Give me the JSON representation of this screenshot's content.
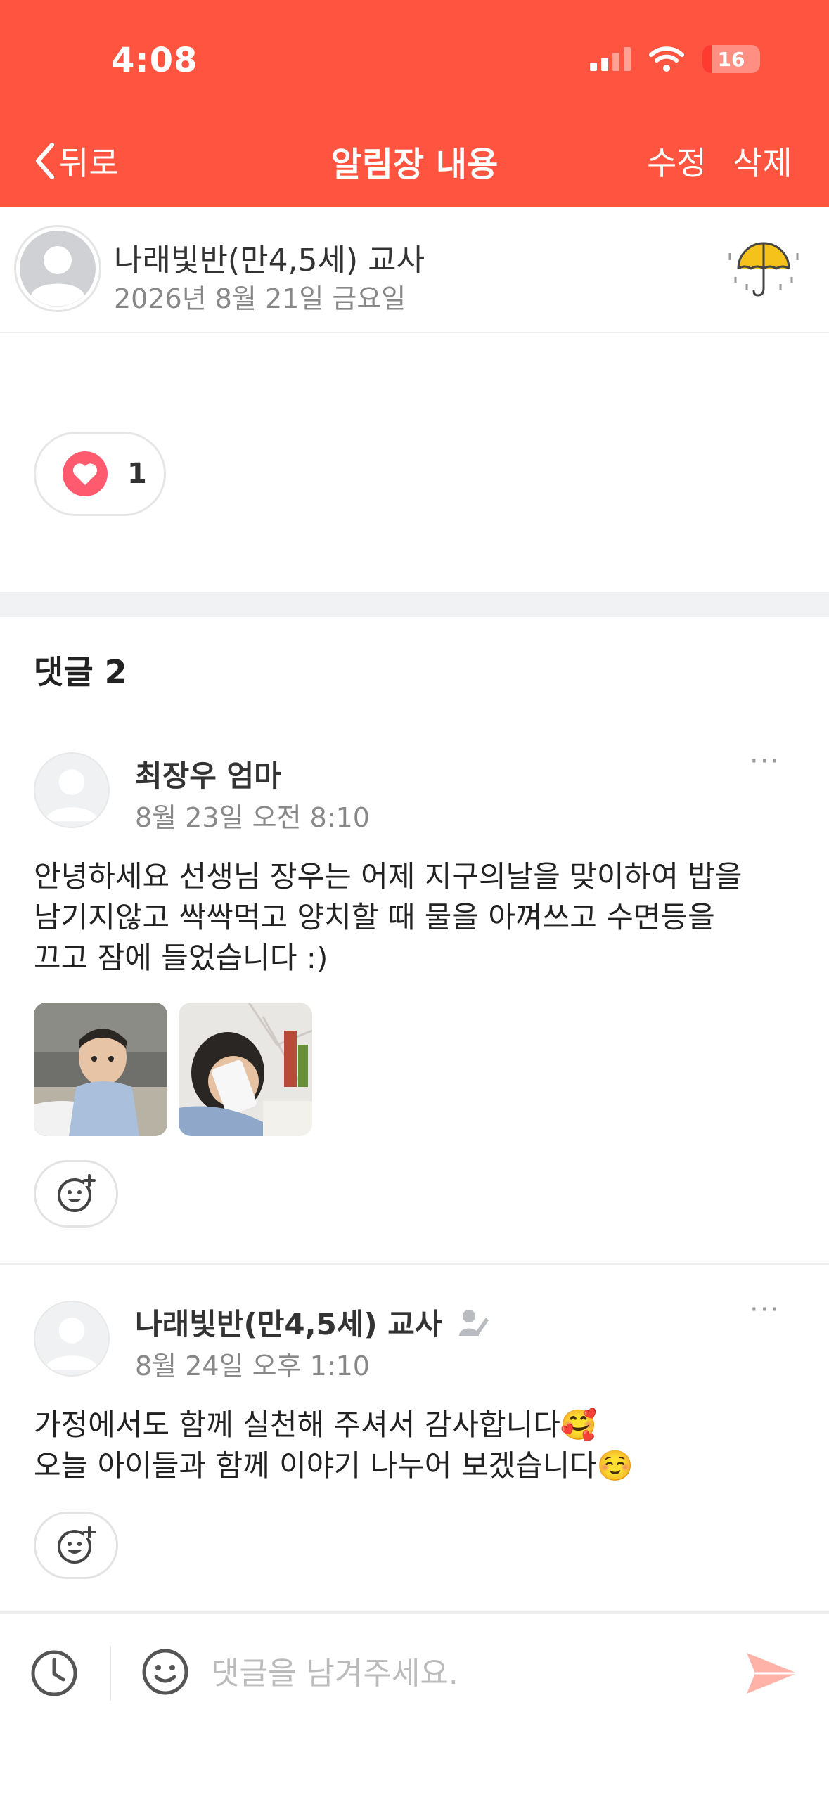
{
  "status_bar": {
    "time": "4:08",
    "battery": "16"
  },
  "nav": {
    "back_label": "뒤로",
    "title": "알림장 내용",
    "edit_label": "수정",
    "delete_label": "삭제"
  },
  "post": {
    "author": "나래빛반(만4,5세) 교사",
    "date": "2026년 8월 21일 금요일",
    "weather_icon": "umbrella-icon",
    "like_count": "1"
  },
  "comments_header": "댓글 2",
  "comments": [
    {
      "author": "최장우 엄마",
      "time": "8월 23일 오전 8:10",
      "more": "···",
      "text_lines": [
        "안녕하세요 선생님 장우는 어제 지구의날을 맞이하여 밥을",
        "남기지않고 싹싹먹고 양치할 때 물을 아껴쓰고 수면등을",
        "끄고 잠에 들었습니다 :)"
      ],
      "photos": 2
    },
    {
      "author": "나래빛반(만4,5세) 교사",
      "time": "8월 24일 오후 1:10",
      "more": "···",
      "text_lines": [
        "가정에서도 함께 실천해 주셔서 감사합니다🥰",
        "오늘 아이들과 함께 이야기 나누어 보겠습니다☺️"
      ]
    }
  ],
  "input": {
    "placeholder": "댓글을 남겨주세요."
  },
  "colors": {
    "brand": "#FF543F",
    "heart": "#FF5A6E",
    "send": "#FFB3A8"
  }
}
